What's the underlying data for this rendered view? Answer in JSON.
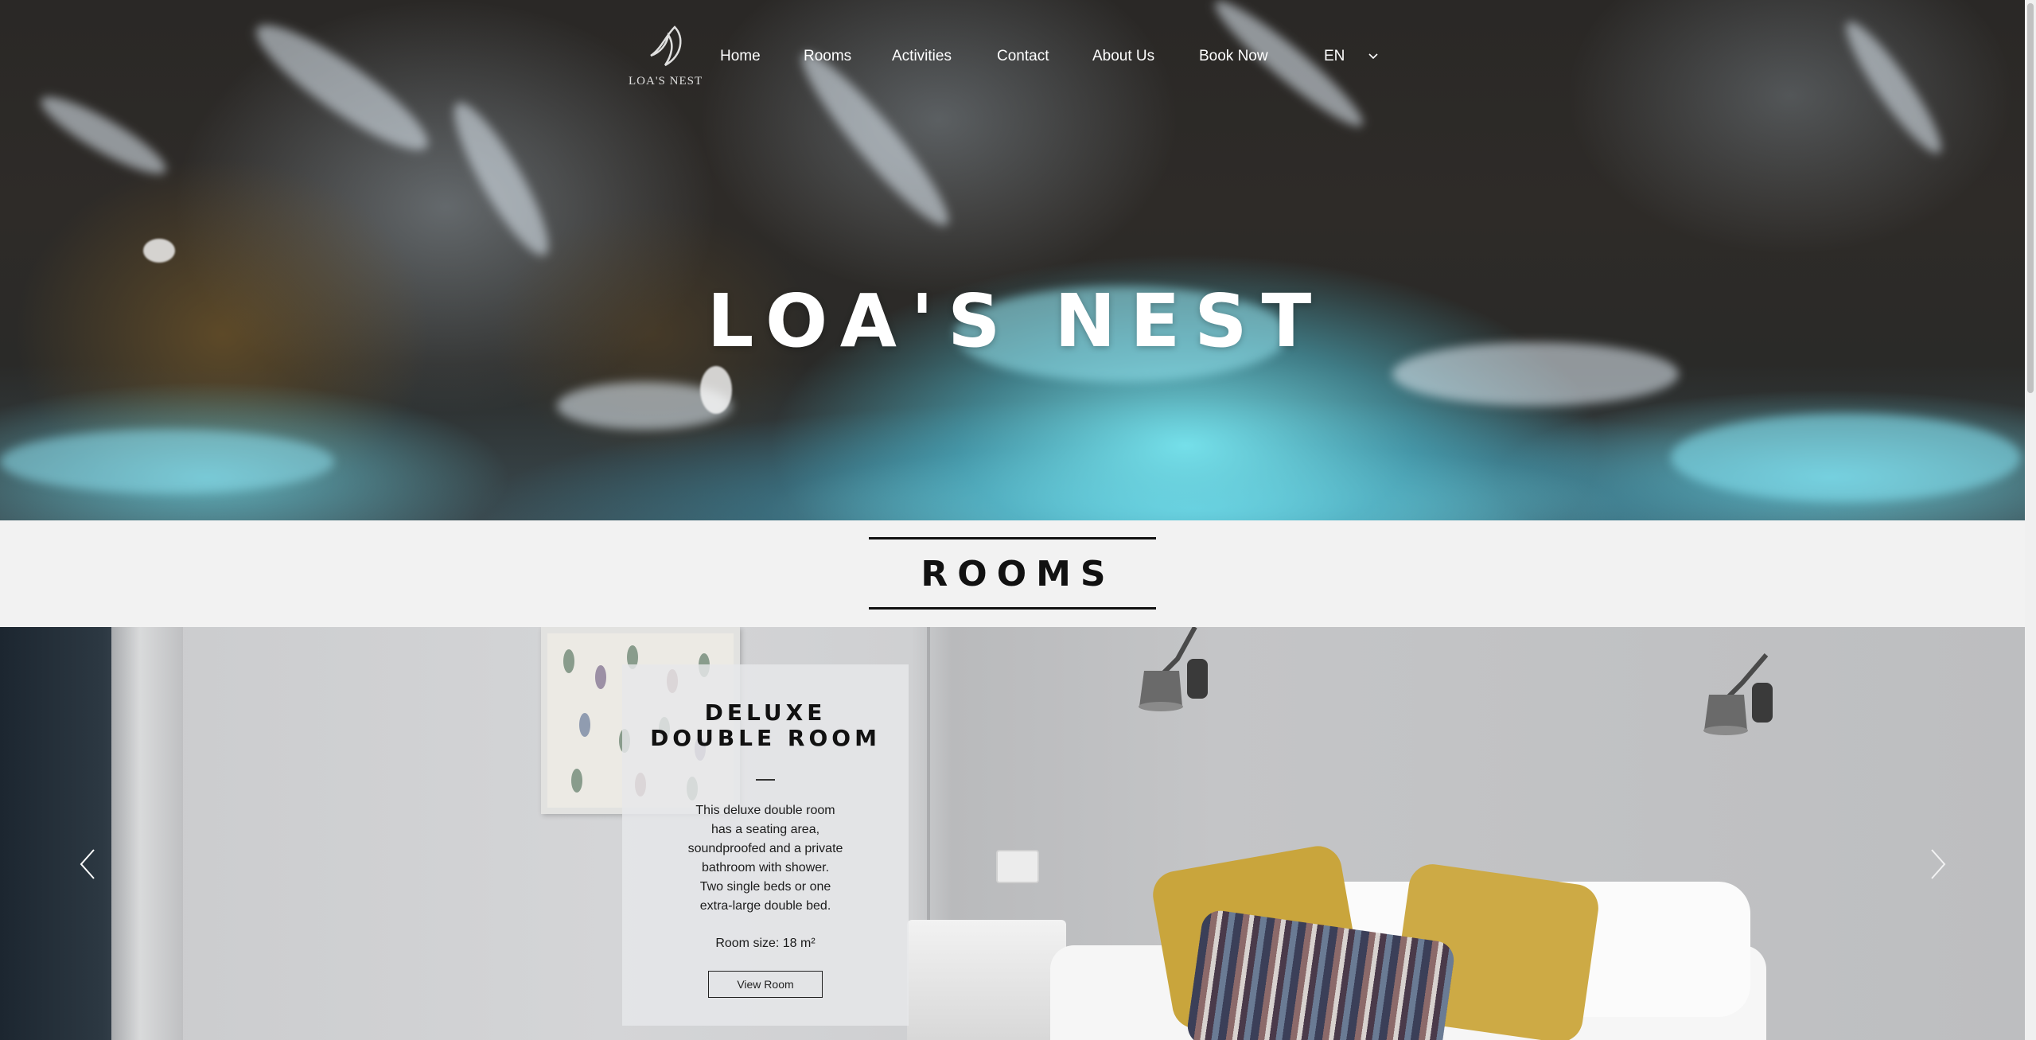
{
  "site": {
    "logo_text": "LOA'S NEST",
    "title": "LOA'S NEST"
  },
  "nav": {
    "items": [
      {
        "label": "Home"
      },
      {
        "label": "Rooms"
      },
      {
        "label": "Activities"
      },
      {
        "label": "Contact"
      },
      {
        "label": "About Us"
      },
      {
        "label": "Book Now"
      }
    ],
    "language": "EN"
  },
  "rooms_section": {
    "heading": "ROOMS"
  },
  "room_card": {
    "title_line1": "DELUXE",
    "title_line2": "DOUBLE ROOM",
    "description_lines": [
      "This deluxe double room",
      "has a seating area,",
      "soundproofed and a private",
      "bathroom with shower.",
      "Two single beds or one",
      "extra-large double bed."
    ],
    "size": "Room size:  18 m²",
    "button_label": "View Room"
  },
  "icons": {
    "logo": "bird-logo-icon",
    "language_toggle": "chevron-down-icon",
    "prev": "chevron-left-icon",
    "next": "chevron-right-icon"
  },
  "colors": {
    "nav_text": "#ffffff",
    "heading": "#111111",
    "band_bg": "#f2f2f2"
  }
}
